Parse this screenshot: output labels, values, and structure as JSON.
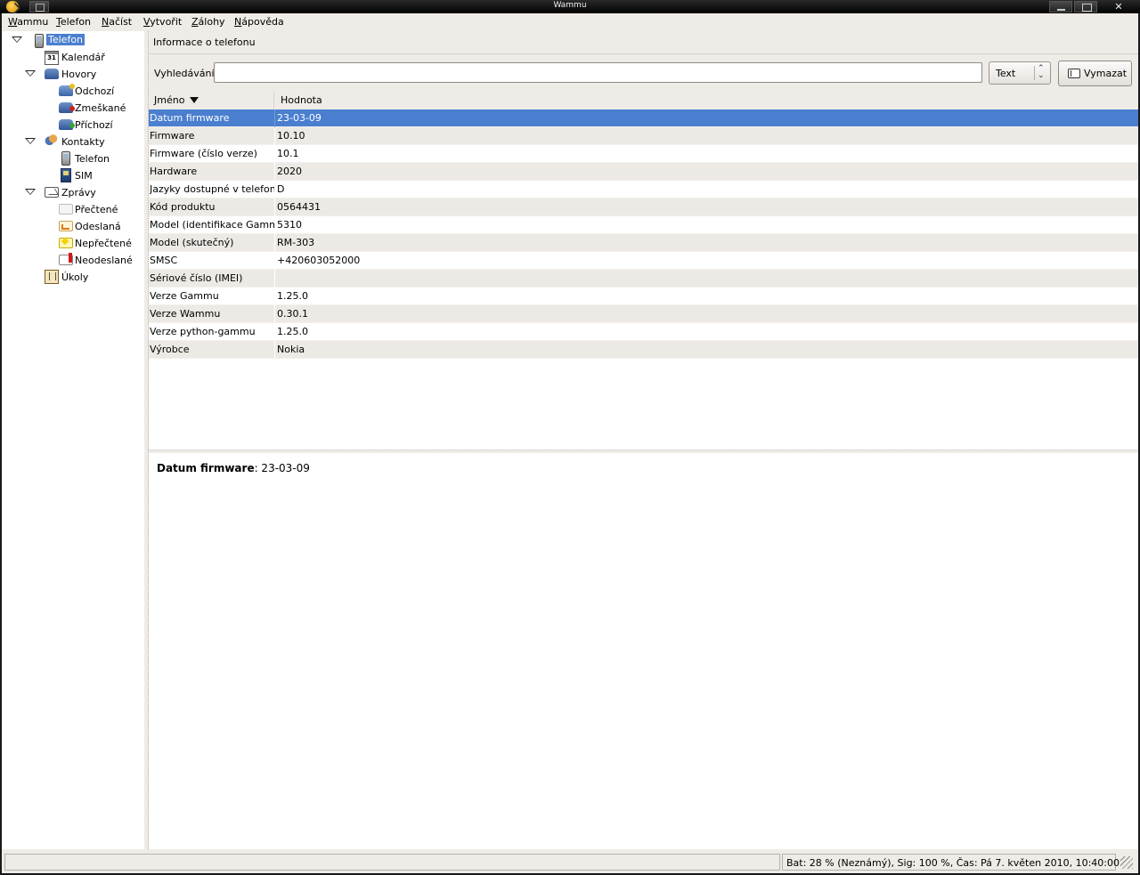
{
  "window": {
    "title": "Wammu"
  },
  "menubar": [
    {
      "label": "Wammu",
      "mnemonic": "W",
      "rest": "ammu"
    },
    {
      "label": "Telefon",
      "mnemonic": "T",
      "rest": "elefon"
    },
    {
      "label": "Načíst",
      "mnemonic": "N",
      "rest": "ačíst"
    },
    {
      "label": "Vytvořit",
      "mnemonic": "V",
      "rest": "ytvořit"
    },
    {
      "label": "Zálohy",
      "mnemonic": "Z",
      "rest": "álohy"
    },
    {
      "label": "Nápověda",
      "mnemonic": "N",
      "rest": "ápověda"
    }
  ],
  "tree": {
    "telefon": "Telefon",
    "kalendar": "Kalendář",
    "calendar_icon_text": "31",
    "hovory": "Hovory",
    "odchozi": "Odchozí",
    "zmeskane": "Zmeškané",
    "prichozi": "Příchozí",
    "kontakty": "Kontakty",
    "kontakty_telefon": "Telefon",
    "sim": "SIM",
    "zpravy": "Zprávy",
    "prectene": "Přečtené",
    "odeslana": "Odeslaná",
    "neprectene": "Nepřečtené",
    "neodeslane": "Neodeslané",
    "ukoly": "Úkoly"
  },
  "pane": {
    "title": "Informace o telefonu",
    "search_label": "Vyhledávání:",
    "search_value": "",
    "type_select": "Text",
    "clear_button": "Vymazat"
  },
  "table": {
    "columns": [
      "Jméno",
      "Hodnota"
    ],
    "sorted_column": "Jméno",
    "sort_direction": "descending",
    "selected_row": 0,
    "rows": [
      {
        "name": "Datum firmware",
        "value": "23-03-09"
      },
      {
        "name": "Firmware",
        "value": "10.10"
      },
      {
        "name": "Firmware (číslo verze)",
        "value": "10.1"
      },
      {
        "name": "Hardware",
        "value": "2020"
      },
      {
        "name": "Jazyky dostupné v telefonu",
        "value": "D"
      },
      {
        "name": "Kód produktu",
        "value": "0564431"
      },
      {
        "name": "Model (identifikace Gammu)",
        "value": "5310"
      },
      {
        "name": "Model (skutečný)",
        "value": "RM-303"
      },
      {
        "name": "SMSC",
        "value": "+420603052000"
      },
      {
        "name": "Sériové číslo (IMEI)",
        "value": ""
      },
      {
        "name": "Verze Gammu",
        "value": "1.25.0"
      },
      {
        "name": "Verze Wammu",
        "value": "0.30.1"
      },
      {
        "name": "Verze python-gammu",
        "value": "1.25.0"
      },
      {
        "name": "Výrobce",
        "value": "Nokia"
      }
    ]
  },
  "detail": {
    "label": "Datum firmware",
    "value": ": 23-03-09"
  },
  "statusbar": {
    "left": "",
    "right": "Bat: 28 % (Neznámý), Sig: 100 %, Čas: Pá 7. květen 2010, 10:40:00"
  },
  "colors": {
    "selection": "#4a7fcf",
    "window_bg": "#efebe7",
    "titlebar": "#000000"
  }
}
